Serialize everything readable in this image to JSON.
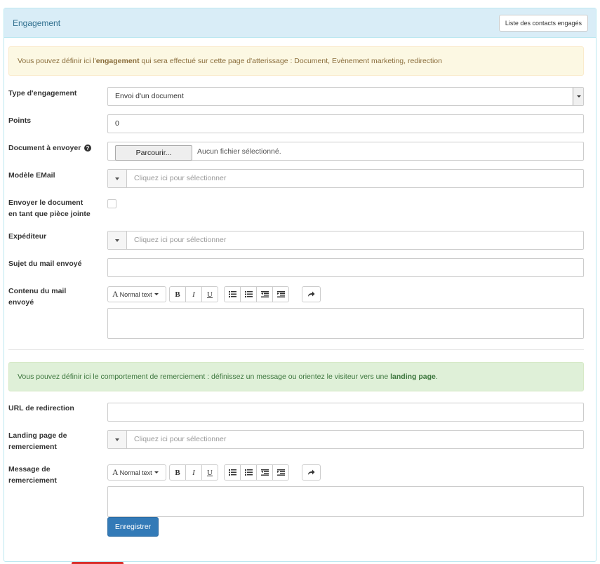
{
  "panel": {
    "title": "Engagement",
    "contacts_button": "Liste des contacts engagés"
  },
  "alert_engagement": {
    "prefix": "Vous pouvez définir ici l'",
    "bold": "engagement",
    "suffix": " qui sera effectué sur cette page d'atterissage : Document, Evènement marketing, redirection"
  },
  "fields": {
    "type": {
      "label": "Type d'engagement",
      "value": "Envoi d'un document"
    },
    "points": {
      "label": "Points",
      "value": "0"
    },
    "document": {
      "label": "Document à envoyer",
      "browse": "Parcourir...",
      "no_file": "Aucun fichier sélectionné."
    },
    "email_template": {
      "label": "Modèle EMail",
      "placeholder": "Cliquez ici pour sélectionner"
    },
    "attach": {
      "label_line1": "Envoyer le document",
      "label_line2": "en tant que pièce jointe"
    },
    "sender": {
      "label": "Expéditeur",
      "placeholder": "Cliquez ici pour sélectionner"
    },
    "subject": {
      "label": "Sujet du mail envoyé",
      "value": ""
    },
    "content": {
      "label_line1": "Contenu du mail",
      "label_line2": "envoyé"
    }
  },
  "editor_toolbar": {
    "font_label": "Normal text",
    "bold": "B",
    "italic": "I",
    "underline": "U"
  },
  "alert_thanks": {
    "prefix": "Vous pouvez définir ici le comportement de remerciement : définissez un message ou orientez le visiteur vers une ",
    "bold": "landing page",
    "suffix": "."
  },
  "thanks_fields": {
    "redirect_url": {
      "label": "URL de redirection",
      "value": ""
    },
    "landing_page": {
      "label_line1": "Landing page de",
      "label_line2": "remerciement",
      "placeholder": "Cliquez ici pour sélectionner"
    },
    "message": {
      "label_line1": "Message de",
      "label_line2": "remerciement"
    }
  },
  "save_button": "Enregistrer",
  "colors": {
    "heading_bg": "#d9edf7",
    "warning_bg": "#fcf8e3",
    "success_bg": "#dff0d8",
    "primary": "#337ab7"
  }
}
